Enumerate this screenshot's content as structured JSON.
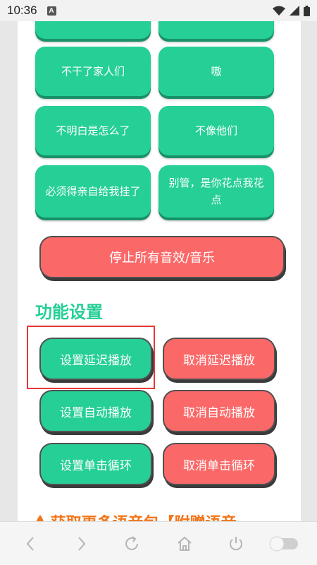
{
  "status_bar": {
    "time": "10:36",
    "notification_glyph": "A",
    "icons": [
      "wifi-icon",
      "signal-icon",
      "battery-icon"
    ]
  },
  "sound_buttons": [
    {
      "label": ""
    },
    {
      "label": ""
    },
    {
      "label": "不干了家人们"
    },
    {
      "label": "嗷"
    },
    {
      "label": "不明白是怎么了"
    },
    {
      "label": "不像他们"
    },
    {
      "label": "必须得亲自给我挂了"
    },
    {
      "label": "别管，是你花点我花点"
    }
  ],
  "stop_all": {
    "label": "停止所有音效/音乐"
  },
  "settings": {
    "title": "功能设置",
    "set_delay": "设置延迟播放",
    "cancel_delay": "取消延迟播放",
    "set_auto": "设置自动播放",
    "cancel_auto": "取消自动播放",
    "set_loop": "设置单击循环",
    "cancel_loop": "取消单击循环"
  },
  "promo_text": "获取更多语音包【附赠语音",
  "colors": {
    "green": "#25cf96",
    "red": "#fb6868",
    "highlight": "#e53935",
    "promo": "#f2761b"
  },
  "nav_icons": [
    "back-icon",
    "forward-icon",
    "refresh-icon",
    "home-icon",
    "power-icon",
    "toggle-switch"
  ]
}
